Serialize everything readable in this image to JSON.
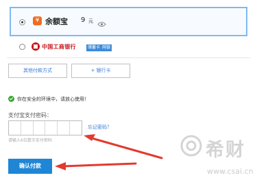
{
  "payment_options": {
    "yuebao": {
      "logo_char": "¥",
      "name": "余额宝",
      "amount": "9",
      "unit": "元",
      "selected": true
    },
    "icbc": {
      "bank_name": "中国工商银行",
      "tags": [
        "储蓄卡",
        "网银"
      ],
      "selected": false
    }
  },
  "buttons": {
    "other_methods": "其他付款方式",
    "add_card": "+ 银行卡",
    "confirm": "确认付款"
  },
  "safety": {
    "text": "你在安全的环境中，请放心使用！"
  },
  "password": {
    "label": "支付宝支付密码：",
    "forgot": "忘记密码？",
    "hint": "请输入6位数字支付密码"
  },
  "watermark": {
    "text": "希财",
    "url": "www.csai.cn"
  },
  "colors": {
    "accent_blue": "#1f86d6",
    "link_blue": "#3a7bd5",
    "selected_border": "#7fb9f0",
    "arrow_red": "#e23a2e",
    "check_green": "#3aa832",
    "icbc_red": "#c8161d"
  }
}
